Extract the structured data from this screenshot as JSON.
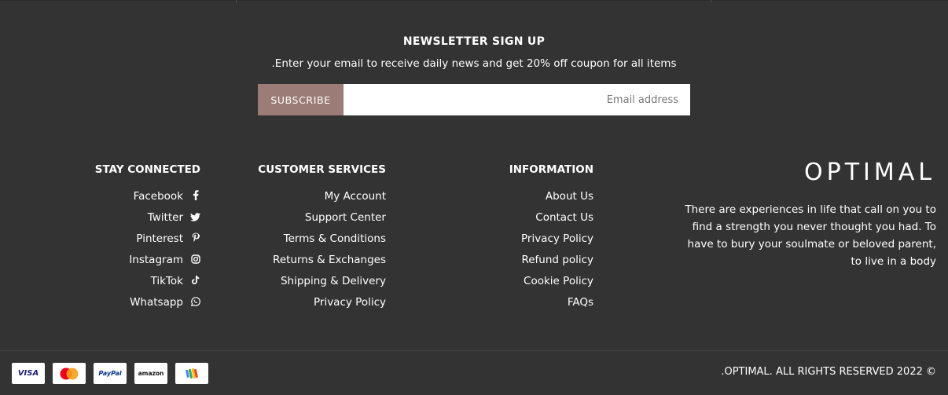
{
  "newsletter": {
    "title": "NEWSLETTER SIGN UP",
    "description": ".Enter your email to receive daily news and get 20% off coupon for all items",
    "subscribe_label": "SUBSCRIBE",
    "email_placeholder": "Email address"
  },
  "stay_connected": {
    "title": "STAY CONNECTED",
    "items": [
      {
        "label": "Facebook",
        "icon": "facebook-icon"
      },
      {
        "label": "Twitter",
        "icon": "twitter-icon"
      },
      {
        "label": "Pinterest",
        "icon": "pinterest-icon"
      },
      {
        "label": "Instagram",
        "icon": "instagram-icon"
      },
      {
        "label": "TikTok",
        "icon": "tiktok-icon"
      },
      {
        "label": "Whatsapp",
        "icon": "whatsapp-icon"
      }
    ]
  },
  "customer_services": {
    "title": "CUSTOMER SERVICES",
    "items": [
      "My Account",
      "Support Center",
      "Terms & Conditions",
      "Returns & Exchanges",
      "Shipping & Delivery",
      "Privacy Policy"
    ]
  },
  "information": {
    "title": "INFORMATION",
    "items": [
      "About Us",
      "Contact Us",
      "Privacy Policy",
      "Refund policy",
      "Cookie Policy",
      "FAQs"
    ]
  },
  "brand": {
    "logo": "OPTIMAL",
    "text": "There are experiences in life that call on you to find a strength you never thought you had. To have to bury your soulmate or beloved parent, to live in a body"
  },
  "payments": [
    {
      "label": "VISA",
      "icon": "visa-card-icon"
    },
    {
      "label": "MasterCard",
      "icon": "mastercard-icon"
    },
    {
      "label": "PayPal",
      "icon": "paypal-icon"
    },
    {
      "label": "amazon",
      "icon": "amazon-icon"
    },
    {
      "label": "",
      "icon": "google-wallet-icon"
    }
  ],
  "copyright": ".OPTIMAL. ALL RIGHTS RESERVED 2022 ©",
  "colors": {
    "background": "#333333",
    "subscribe_button": "#9b7c77",
    "text": "#ffffff"
  }
}
